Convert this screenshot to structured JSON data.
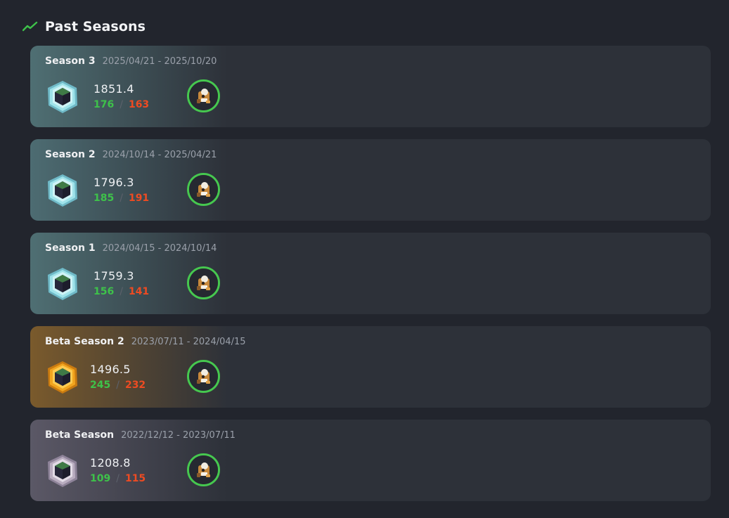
{
  "header": {
    "title": "Past Seasons",
    "icon": "trend-line-icon",
    "accent_color": "#3ec24a"
  },
  "seasons": [
    {
      "name": "Season 3",
      "dates": "2025/04/21 - 2025/10/20",
      "rating": "1851.4",
      "wins": "176",
      "losses": "163",
      "emblem": "diamond-rank-icon",
      "glow_color": "#4f6f73"
    },
    {
      "name": "Season 2",
      "dates": "2024/10/14 - 2025/04/21",
      "rating": "1796.3",
      "wins": "185",
      "losses": "191",
      "emblem": "diamond-rank-icon",
      "glow_color": "#4d6c72"
    },
    {
      "name": "Season 1",
      "dates": "2024/04/15 - 2024/10/14",
      "rating": "1759.3",
      "wins": "156",
      "losses": "141",
      "emblem": "diamond-rank-icon",
      "glow_color": "#4f6f73"
    },
    {
      "name": "Beta Season 2",
      "dates": "2023/07/11 - 2024/04/15",
      "rating": "1496.5",
      "wins": "245",
      "losses": "232",
      "emblem": "gold-rank-icon",
      "glow_color": "#7a5a2c"
    },
    {
      "name": "Beta Season",
      "dates": "2022/12/12 - 2023/07/11",
      "rating": "1208.8",
      "wins": "109",
      "losses": "115",
      "emblem": "silver-rank-icon",
      "glow_color": "#5b5866"
    }
  ],
  "colors": {
    "win": "#3ec24a",
    "loss": "#ee4b22",
    "ring": "#46c84f"
  }
}
